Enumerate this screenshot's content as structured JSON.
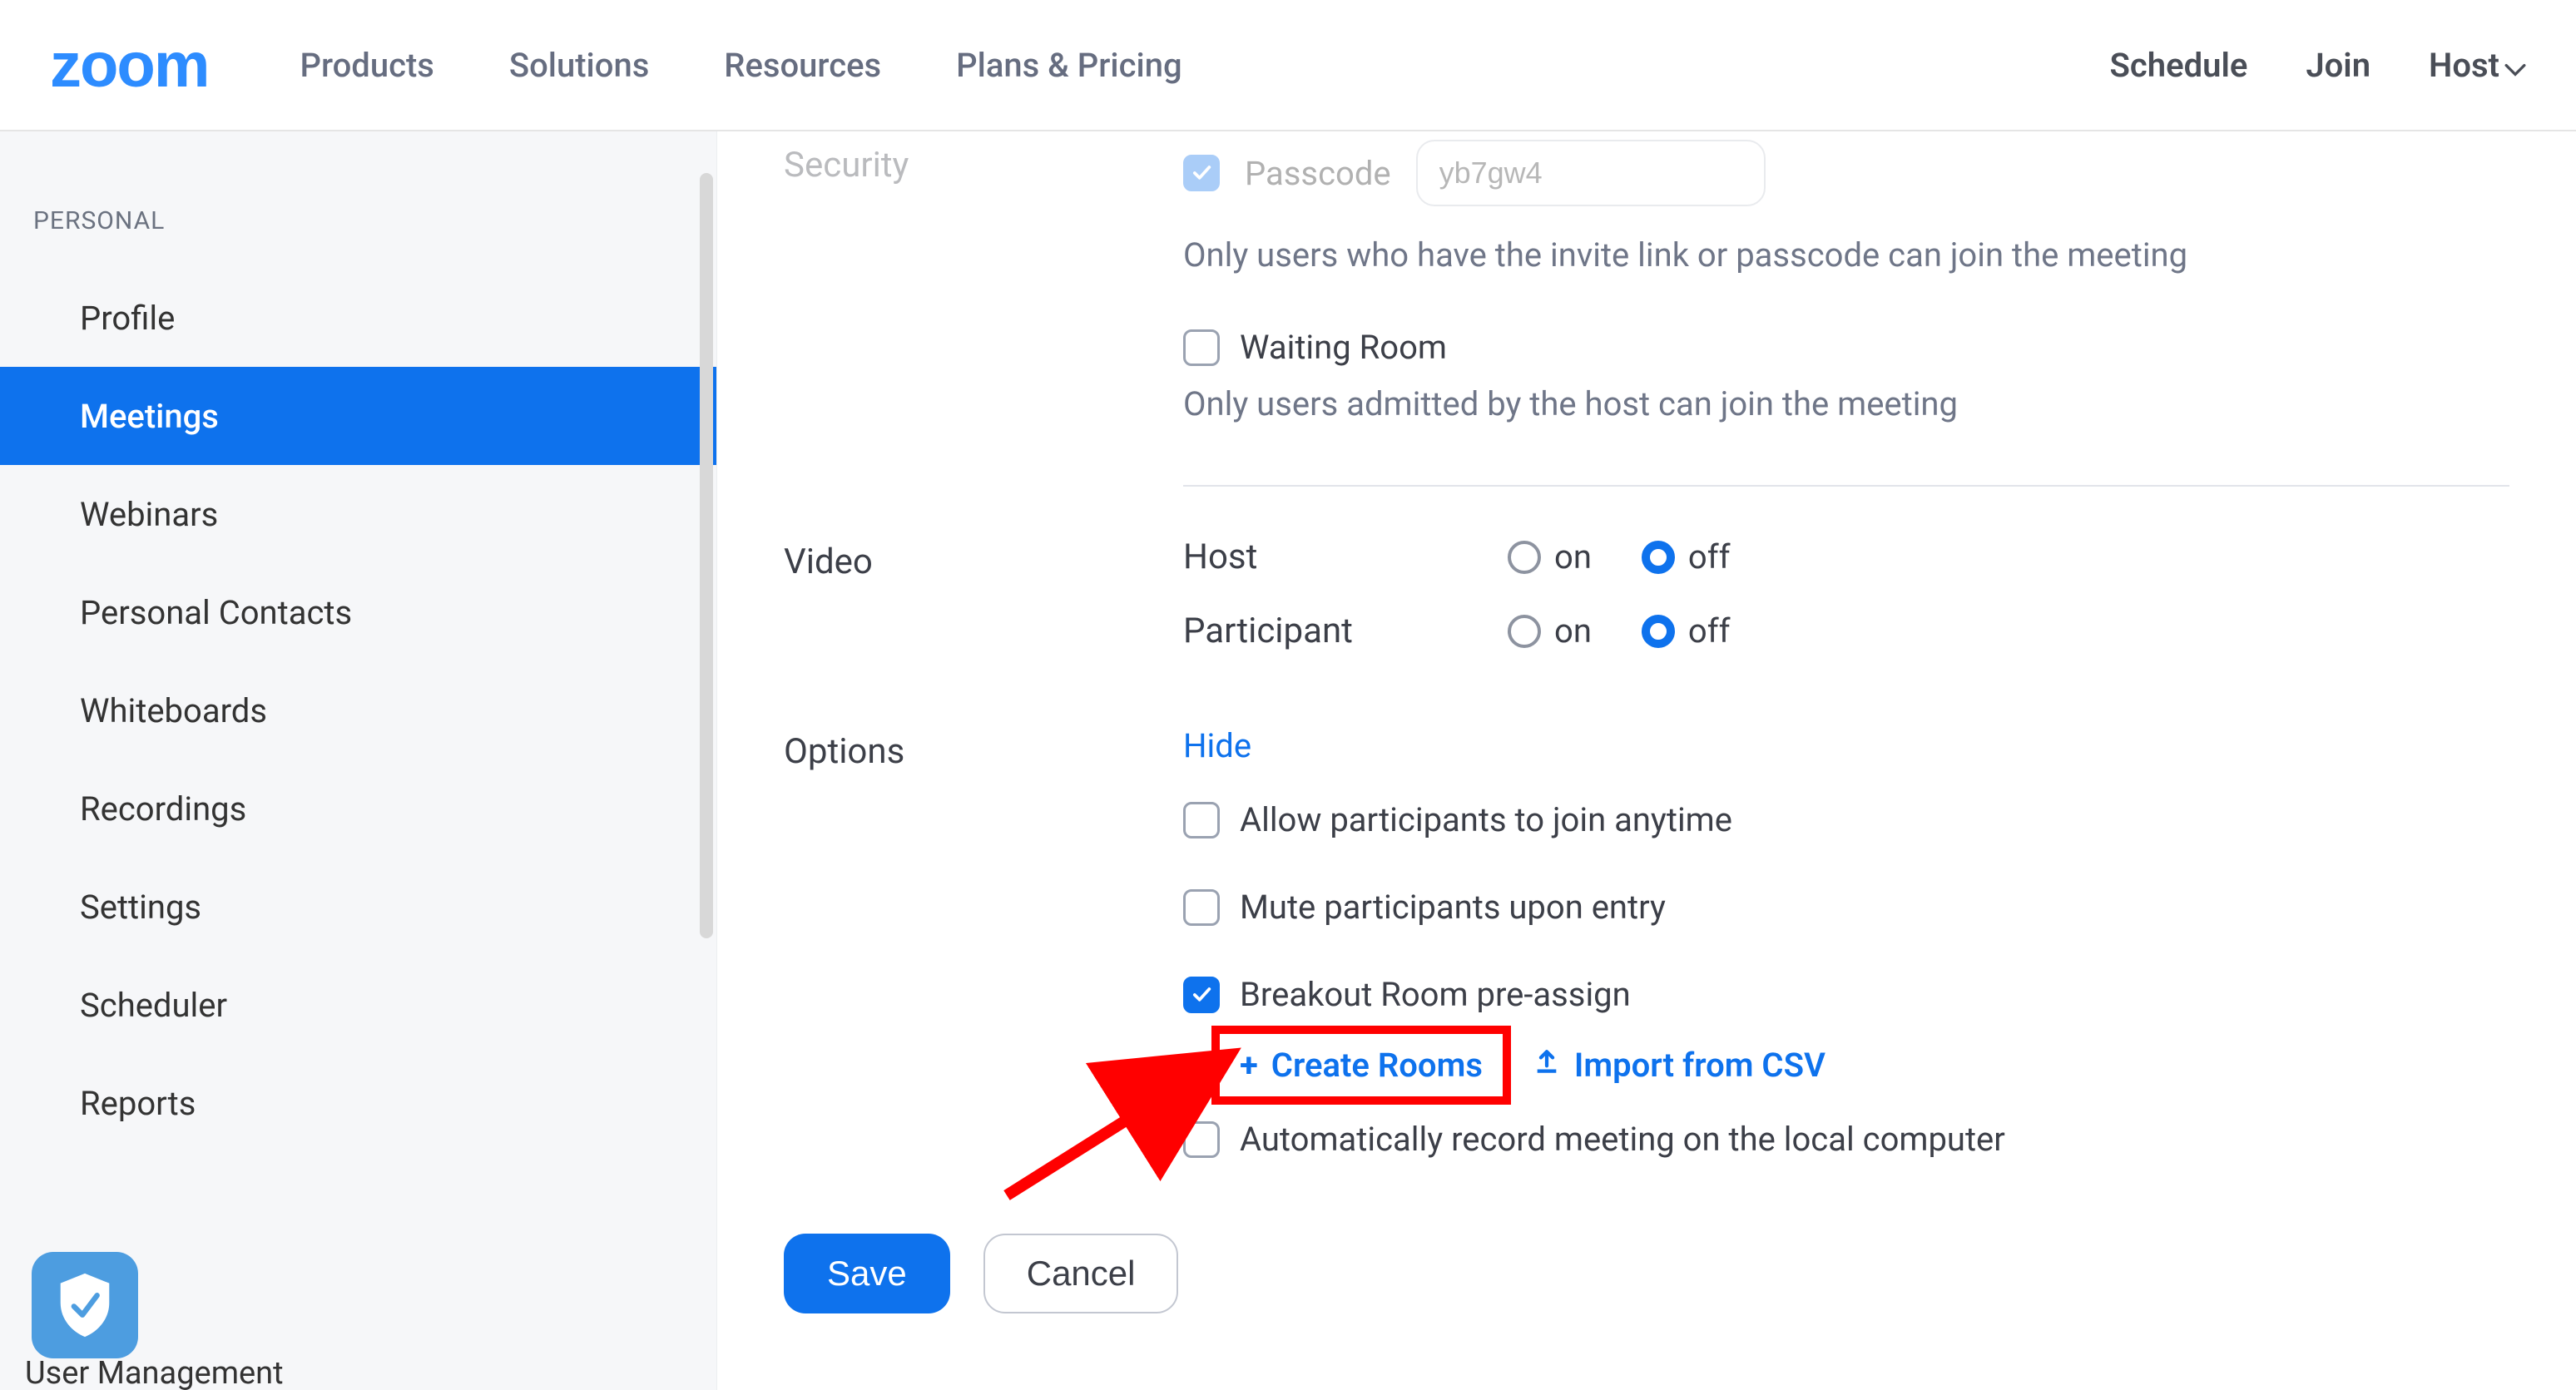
{
  "brand": "zoom",
  "nav": {
    "products": "Products",
    "solutions": "Solutions",
    "resources": "Resources",
    "plans": "Plans & Pricing",
    "schedule": "Schedule",
    "join": "Join",
    "host": "Host"
  },
  "sidebar": {
    "section": "PERSONAL",
    "items": [
      "Profile",
      "Meetings",
      "Webinars",
      "Personal Contacts",
      "Whiteboards",
      "Recordings",
      "Settings",
      "Scheduler",
      "Reports"
    ],
    "bottom_partial": "User Management"
  },
  "security": {
    "label": "Security",
    "passcode_label": "Passcode",
    "passcode_value": "yb7gw4",
    "passcode_desc": "Only users who have the invite link or passcode can join the meeting",
    "waiting_room_label": "Waiting Room",
    "waiting_room_desc": "Only users admitted by the host can join the meeting"
  },
  "video": {
    "label": "Video",
    "host_label": "Host",
    "participant_label": "Participant",
    "on_label": "on",
    "off_label": "off",
    "host_value": "off",
    "participant_value": "off"
  },
  "options": {
    "label": "Options",
    "hide": "Hide",
    "allow_join_anytime": "Allow participants to join anytime",
    "mute_on_entry": "Mute participants upon entry",
    "breakout": "Breakout Room pre-assign",
    "create_rooms": "Create Rooms",
    "import_csv": "Import from CSV",
    "auto_record": "Automatically record meeting on the local computer"
  },
  "footer": {
    "save": "Save",
    "cancel": "Cancel"
  },
  "colors": {
    "accent": "#0e72ed",
    "highlight": "#f00"
  }
}
